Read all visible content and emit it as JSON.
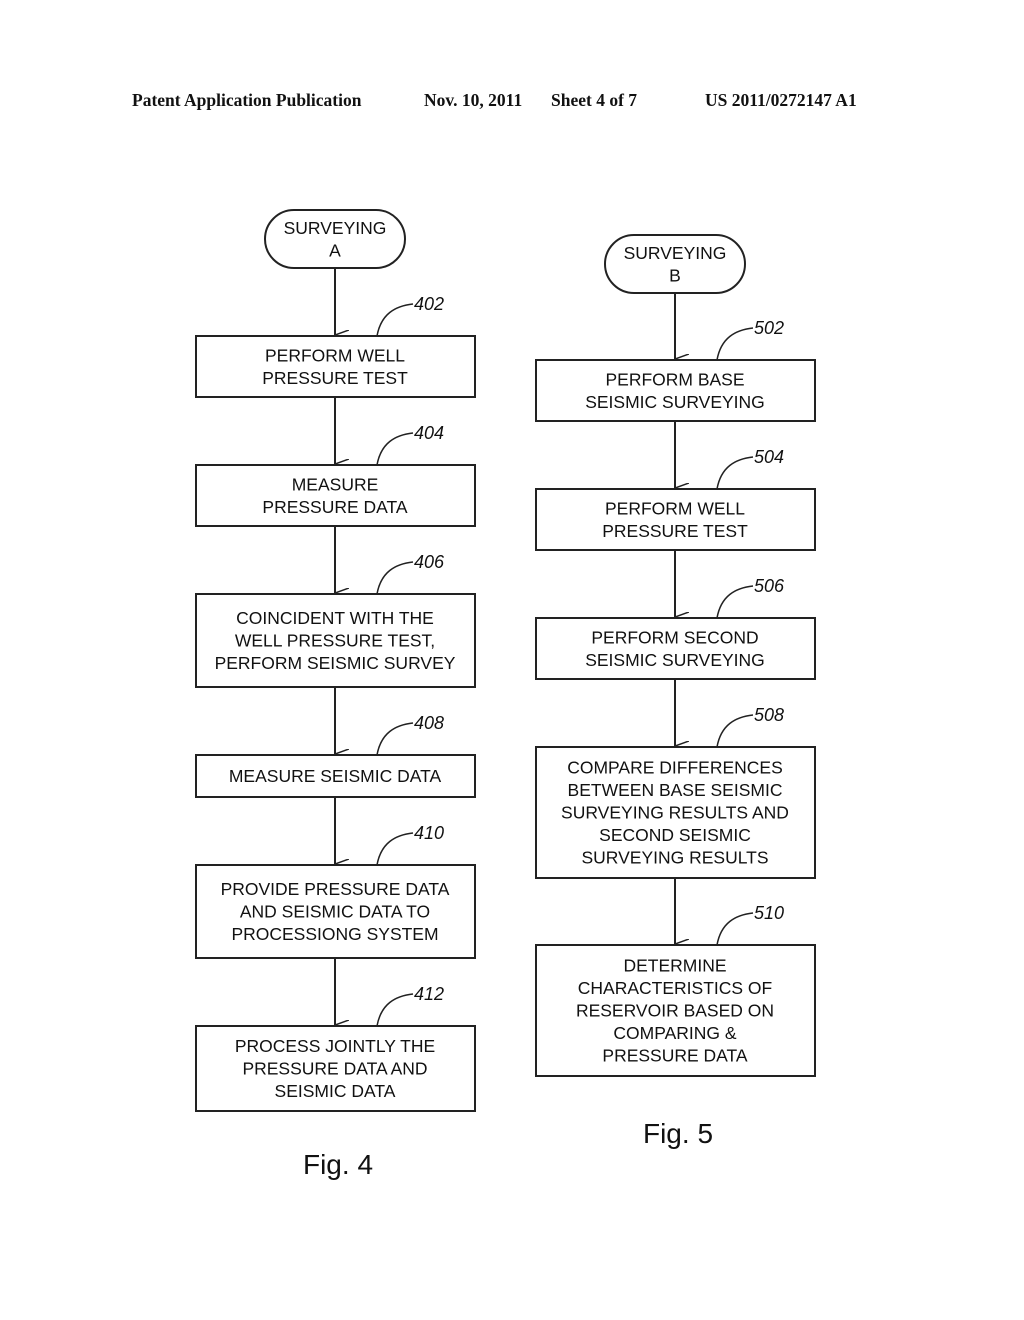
{
  "header": {
    "publication": "Patent Application Publication",
    "date": "Nov. 10, 2011",
    "sheet": "Sheet 4 of 7",
    "number": "US 2011/0272147 A1"
  },
  "fig4": {
    "caption": "Fig. 4",
    "start": {
      "lines": [
        "SURVEYING",
        "A"
      ]
    },
    "steps": [
      {
        "ref": "402",
        "lines": [
          "PERFORM WELL",
          "PRESSURE TEST"
        ]
      },
      {
        "ref": "404",
        "lines": [
          "MEASURE",
          "PRESSURE DATA"
        ]
      },
      {
        "ref": "406",
        "lines": [
          "COINCIDENT WITH THE",
          "WELL PRESSURE TEST,",
          "PERFORM SEISMIC SURVEY"
        ]
      },
      {
        "ref": "408",
        "lines": [
          "MEASURE SEISMIC DATA"
        ]
      },
      {
        "ref": "410",
        "lines": [
          "PROVIDE PRESSURE DATA",
          "AND SEISMIC DATA TO",
          "PROCESSIONG SYSTEM"
        ]
      },
      {
        "ref": "412",
        "lines": [
          "PROCESS JOINTLY THE",
          "PRESSURE DATA AND",
          "SEISMIC DATA"
        ]
      }
    ]
  },
  "fig5": {
    "caption": "Fig. 5",
    "start": {
      "lines": [
        "SURVEYING",
        "B"
      ]
    },
    "steps": [
      {
        "ref": "502",
        "lines": [
          "PERFORM BASE",
          "SEISMIC SURVEYING"
        ]
      },
      {
        "ref": "504",
        "lines": [
          "PERFORM WELL",
          "PRESSURE TEST"
        ]
      },
      {
        "ref": "506",
        "lines": [
          "PERFORM SECOND",
          "SEISMIC SURVEYING"
        ]
      },
      {
        "ref": "508",
        "lines": [
          "COMPARE DIFFERENCES",
          "BETWEEN BASE SEISMIC",
          "SURVEYING RESULTS AND",
          "SECOND SEISMIC",
          "SURVEYING RESULTS"
        ]
      },
      {
        "ref": "510",
        "lines": [
          "DETERMINE",
          "CHARACTERISTICS OF",
          "RESERVOIR BASED ON",
          "COMPARING &",
          "PRESSURE DATA"
        ]
      }
    ]
  }
}
